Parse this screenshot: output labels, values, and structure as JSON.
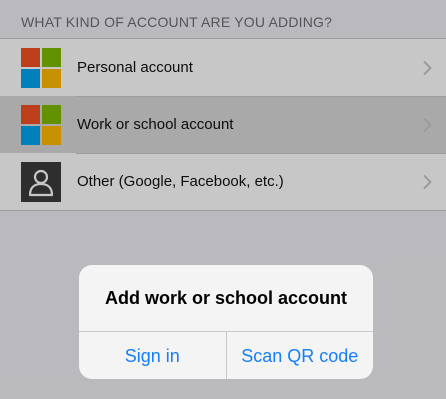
{
  "section_header": "WHAT KIND OF ACCOUNT ARE YOU ADDING?",
  "rows": [
    {
      "label": "Personal account",
      "icon": "microsoft-logo-icon"
    },
    {
      "label": "Work or school account",
      "icon": "microsoft-logo-icon",
      "selected": true
    },
    {
      "label": "Other (Google, Facebook, etc.)",
      "icon": "person-icon"
    }
  ],
  "alert": {
    "title": "Add work or school account",
    "sign_in": "Sign in",
    "scan_qr": "Scan QR code"
  },
  "colors": {
    "accent": "#157efb",
    "ms_red": "#f25022",
    "ms_green": "#7fba00",
    "ms_blue": "#00a4ef",
    "ms_yellow": "#ffb900"
  }
}
